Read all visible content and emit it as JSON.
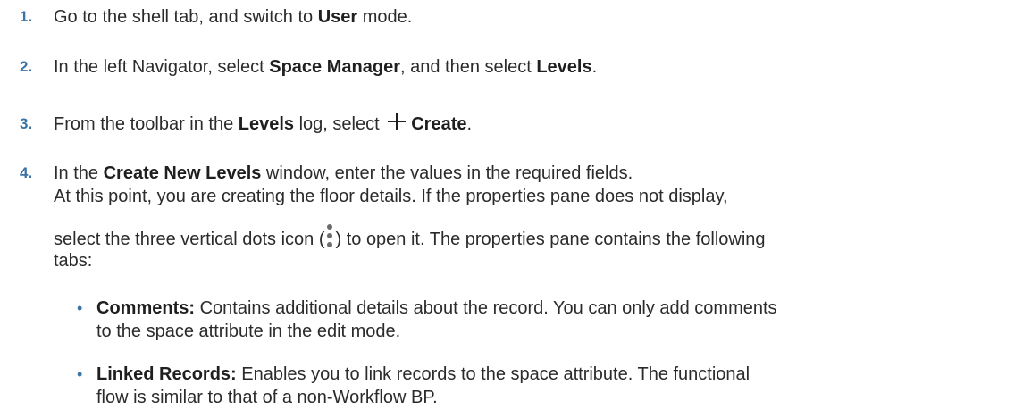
{
  "steps": [
    {
      "number": "1.",
      "parts": [
        "Go to the shell tab, and switch to ",
        "User",
        " mode."
      ]
    },
    {
      "number": "2.",
      "parts": [
        "In the left Navigator, select ",
        "Space Manager",
        ", and then select ",
        "Levels",
        "."
      ]
    },
    {
      "number": "3.",
      "parts": [
        "From the toolbar in the ",
        "Levels",
        " log, select ",
        "Create",
        "."
      ],
      "icon": "plus-icon"
    },
    {
      "number": "4.",
      "line1": [
        "In the ",
        "Create New Levels",
        " window, enter the values in the required fields."
      ],
      "line2": "At this point, you are creating the floor details. If the properties pane does not display,",
      "line3a": "select the three vertical dots icon (",
      "icon": "three-vertical-dots-icon",
      "line3b": ") to open it. The properties pane contains the following",
      "line4": "tabs:"
    }
  ],
  "bullets": [
    {
      "label": "Comments:",
      "line1": " Contains additional details about the record. You can only add comments",
      "line2": "to the space attribute in the edit mode."
    },
    {
      "label": "Linked Records:",
      "line1": " Enables you to link records to the space attribute. The functional",
      "line2": "flow is similar to that of a non-Workflow BP."
    }
  ],
  "bullet_glyph": "•",
  "colors": {
    "step_number": "#3a73a6",
    "text": "#2b2b2b"
  }
}
